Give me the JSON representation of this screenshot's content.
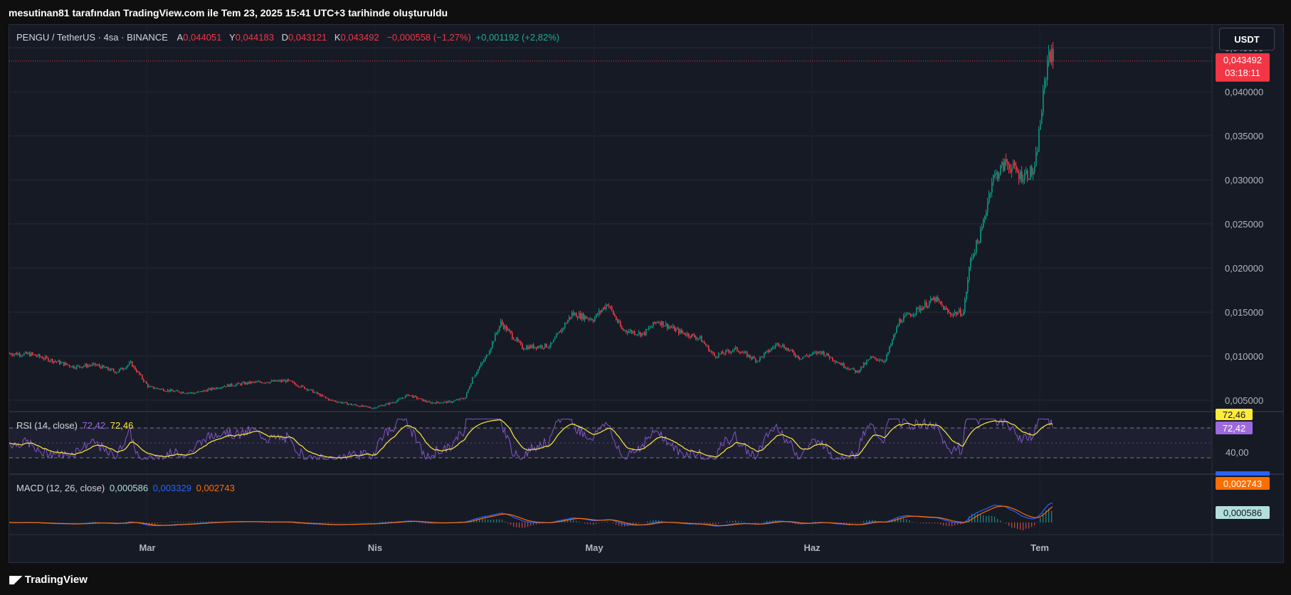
{
  "caption": "mesutinan81 tarafından TradingView.com ile Tem 23, 2025 15:41 UTC+3 tarihinde oluşturuldu",
  "legend": {
    "symbol": "PENGU / TetherUS · 4sa · BINANCE",
    "open_key": "A",
    "open": "0,044051",
    "high_key": "Y",
    "high": "0,044183",
    "low_key": "D",
    "low": "0,043121",
    "close_key": "K",
    "close": "0,043492",
    "change": "−0,000558 (−1,27%)",
    "change2": "+0,001192 (+2,82%)"
  },
  "currency_button": "USDT",
  "price_tag": {
    "value": "0,043492",
    "countdown": "03:18:11"
  },
  "rsi": {
    "label": "RSI (14, close)",
    "value": "72,42",
    "ma_value": "72,46",
    "axis_label": "40,00",
    "colors": {
      "rsi": "#7e57c2",
      "ma": "#ffeb3b"
    }
  },
  "macd": {
    "label": "MACD (12, 26, close)",
    "histogram": "0,000586",
    "macd_line": "0,003329",
    "signal": "0,002743",
    "colors": {
      "macd": "#2962ff",
      "signal": "#ff6d00",
      "hist": "#b2dfdb"
    }
  },
  "footer": {
    "brand": "TradingView",
    "logo_icon": "tradingview-logo-icon"
  },
  "colors": {
    "up": "#089981",
    "down": "#f23645",
    "background": "#161a25"
  },
  "chart_data": {
    "type": "candlestick",
    "x_labels": [
      "Mar",
      "Nis",
      "May",
      "Haz",
      "Tem"
    ],
    "y_ticks": [
      "0,045000",
      "0,040000",
      "0,035000",
      "0,030000",
      "0,025000",
      "0,020000",
      "0,015000",
      "0,010000",
      "0,005000"
    ],
    "y_values": [
      0.045,
      0.04,
      0.035,
      0.03,
      0.025,
      0.02,
      0.015,
      0.01,
      0.005
    ],
    "ylim": [
      0.0037,
      0.0476
    ],
    "last_price": 0.043492,
    "price_path": [
      [
        0,
        0.0103
      ],
      [
        30,
        0.0102
      ],
      [
        60,
        0.0095
      ],
      [
        90,
        0.0088
      ],
      [
        120,
        0.009
      ],
      [
        150,
        0.0082
      ],
      [
        170,
        0.0092
      ],
      [
        195,
        0.0065
      ],
      [
        230,
        0.006
      ],
      [
        260,
        0.0058
      ],
      [
        300,
        0.0066
      ],
      [
        340,
        0.007
      ],
      [
        390,
        0.0072
      ],
      [
        420,
        0.0062
      ],
      [
        450,
        0.005
      ],
      [
        480,
        0.0045
      ],
      [
        510,
        0.0041
      ],
      [
        540,
        0.0048
      ],
      [
        560,
        0.0056
      ],
      [
        590,
        0.0047
      ],
      [
        620,
        0.0048
      ],
      [
        640,
        0.0053
      ],
      [
        650,
        0.0075
      ],
      [
        670,
        0.01
      ],
      [
        690,
        0.0138
      ],
      [
        720,
        0.011
      ],
      [
        760,
        0.0112
      ],
      [
        790,
        0.0148
      ],
      [
        820,
        0.0142
      ],
      [
        840,
        0.016
      ],
      [
        860,
        0.013
      ],
      [
        890,
        0.0125
      ],
      [
        910,
        0.014
      ],
      [
        940,
        0.0128
      ],
      [
        970,
        0.012
      ],
      [
        990,
        0.01
      ],
      [
        1020,
        0.0108
      ],
      [
        1050,
        0.0095
      ],
      [
        1080,
        0.0115
      ],
      [
        1110,
        0.0098
      ],
      [
        1140,
        0.0105
      ],
      [
        1170,
        0.009
      ],
      [
        1190,
        0.0082
      ],
      [
        1210,
        0.0098
      ],
      [
        1230,
        0.0095
      ],
      [
        1250,
        0.014
      ],
      [
        1280,
        0.0155
      ],
      [
        1300,
        0.0165
      ],
      [
        1320,
        0.0148
      ],
      [
        1340,
        0.015
      ],
      [
        1350,
        0.021
      ],
      [
        1365,
        0.024
      ],
      [
        1380,
        0.03
      ],
      [
        1400,
        0.032
      ],
      [
        1420,
        0.0305
      ],
      [
        1440,
        0.031
      ],
      [
        1450,
        0.038
      ],
      [
        1460,
        0.0448
      ],
      [
        1466,
        0.0435
      ]
    ]
  }
}
